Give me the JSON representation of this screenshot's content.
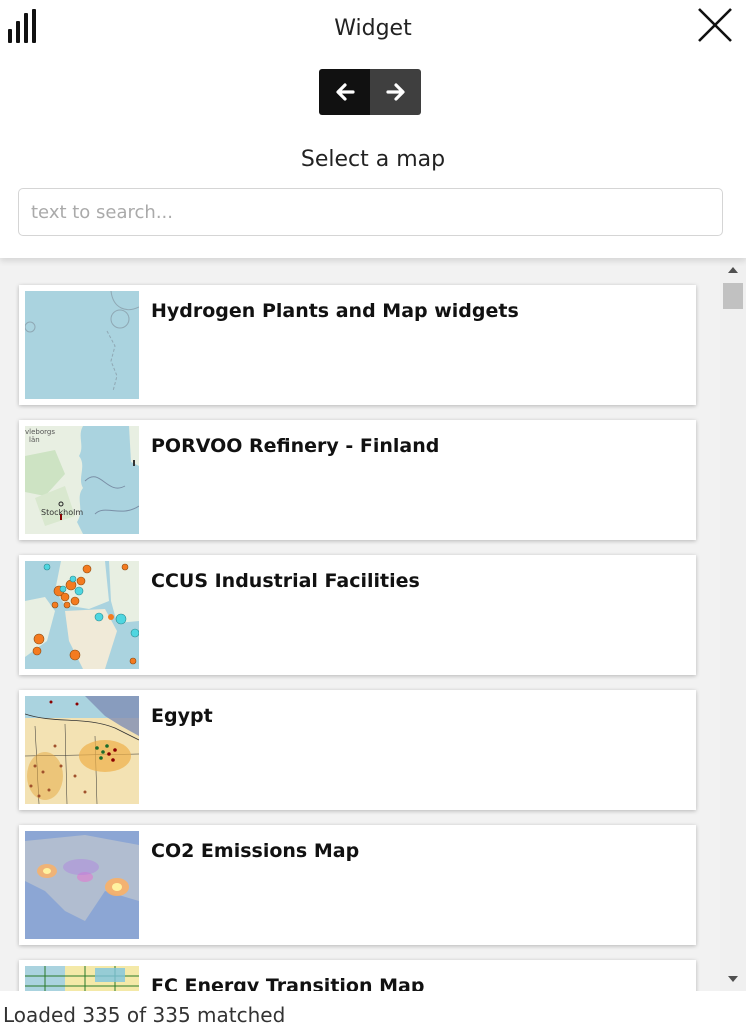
{
  "header": {
    "title": "Widget",
    "subtitle": "Select a map",
    "menu_icon": "bar-chart-icon",
    "close_icon": "close-icon",
    "prev_icon": "arrow-left-icon",
    "next_icon": "arrow-right-icon"
  },
  "search": {
    "placeholder": "text to search...",
    "value": ""
  },
  "maps": [
    {
      "title": "Hydrogen Plants and Map widgets"
    },
    {
      "title": "PORVOO Refinery - Finland"
    },
    {
      "title": "CCUS Industrial Facilities"
    },
    {
      "title": "Egypt"
    },
    {
      "title": "CO2 Emissions Map"
    },
    {
      "title": "FC Energy Transition Map"
    }
  ],
  "thumb_labels": {
    "stockholm": "Stockholm",
    "gavleborgs": "vleborgs",
    "lan": "län"
  },
  "status": "Loaded 335 of 335 matched",
  "colors": {
    "accent_dark": "#111111",
    "nav_next": "#3f3f3f",
    "ocean": "#aad3df",
    "orange_marker": "#f47b20",
    "cyan_marker": "#4fd6e0"
  }
}
